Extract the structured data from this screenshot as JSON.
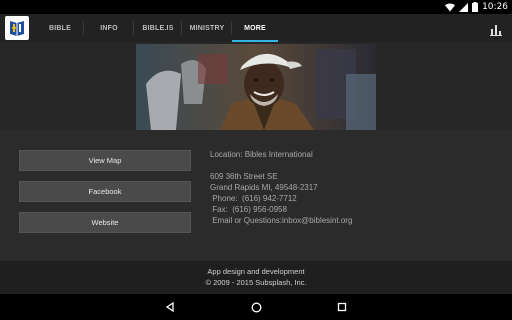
{
  "status_bar": {
    "time": "10:26",
    "icons": [
      "wifi-icon",
      "cell-signal-icon",
      "battery-icon"
    ]
  },
  "app_bar": {
    "logo_icon": "bible-logo-icon",
    "tabs": [
      {
        "label": "BIBLE",
        "active": false
      },
      {
        "label": "INFO",
        "active": false
      },
      {
        "label": "BIBLE.IS",
        "active": false
      },
      {
        "label": "MINISTRY",
        "active": false
      },
      {
        "label": "MORE",
        "active": true
      }
    ],
    "action_icon": "bar-chart-icon",
    "accent_color": "#33b5e5"
  },
  "hero": {
    "image": "photo of smiling elderly man wearing a white cap"
  },
  "buttons": {
    "view_map": "View Map",
    "facebook": "Facebook",
    "website": "Website"
  },
  "info": {
    "location": "Location: Bibles International",
    "address_line1": "609 36th Street SE",
    "address_line2": "Grand Rapids MI, 49548-2317",
    "phone": " Phone:  (616) 942-7712",
    "fax": " Fax:  (616) 956-0958",
    "email": " Email or Questions:inbox@biblesint.org"
  },
  "footer": {
    "line1": "App design and development",
    "line2": "© 2009 - 2015 Subsplash, Inc."
  },
  "nav_bar": {
    "icons": [
      "back-icon",
      "home-icon",
      "recents-icon"
    ]
  }
}
